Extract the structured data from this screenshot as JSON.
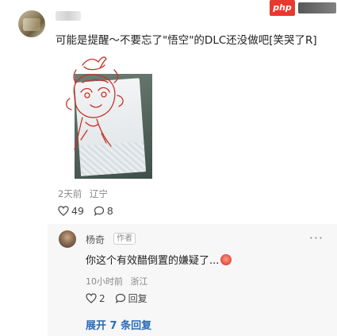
{
  "post": {
    "comment": "可能是提醒～不要忘了\"悟空\"的DLC还没做吧[笑哭了R]",
    "time": "2天前",
    "location": "辽宁",
    "likes": "49",
    "replies": "8"
  },
  "reply": {
    "name": "杨奇",
    "tag": "作者",
    "text": "你这个有效醋倒置的嫌疑了...",
    "time": "10小时前",
    "location": "浙江",
    "likes": "2",
    "reply_label": "回复"
  },
  "expand_label": "展开 7 条回复",
  "watermark": "php",
  "colors": {
    "accent_link": "#2a6ab8",
    "logo_red": "#e8392e"
  },
  "icons": [
    "heart-icon",
    "comment-bubble-icon",
    "more-icon",
    "reply-bubble-icon"
  ]
}
